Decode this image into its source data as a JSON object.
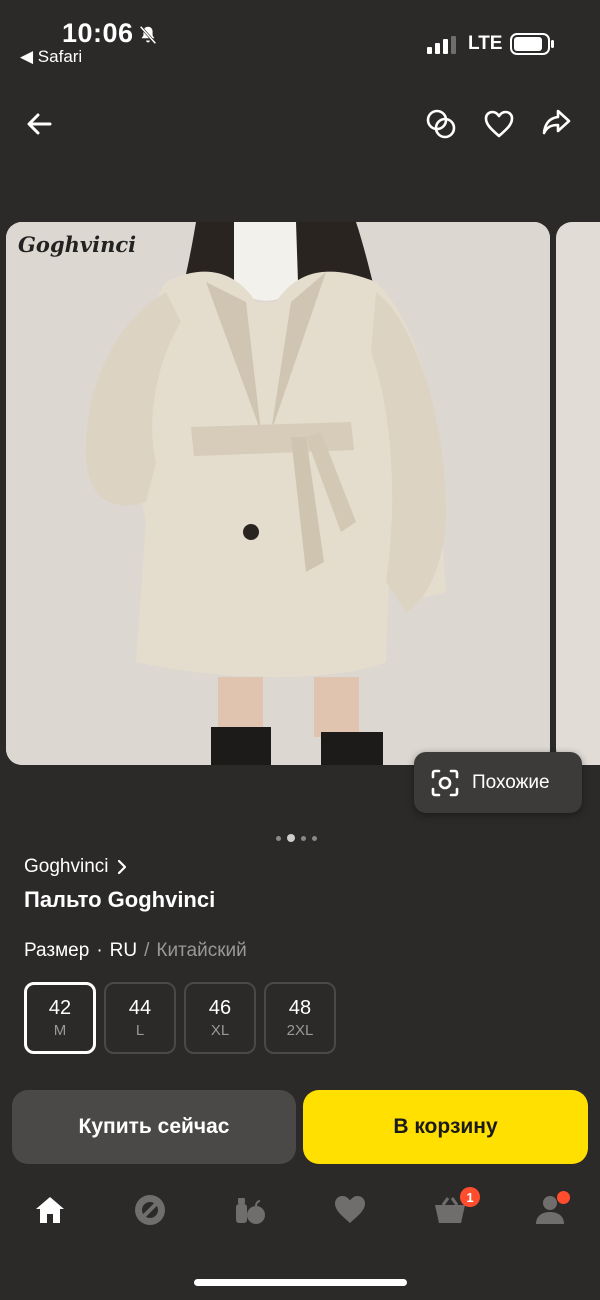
{
  "status_bar": {
    "time": "10:06",
    "back_app": "◀ Safari",
    "network": "LTE"
  },
  "toolbar": {
    "back_icon": "arrow-left-icon",
    "compare_icon": "compare-icon",
    "favorite_icon": "heart-icon",
    "share_icon": "share-icon"
  },
  "gallery": {
    "watermark": "Goghvinci",
    "similar_label": "Похожие",
    "page_count": 4,
    "current_page": 2
  },
  "product": {
    "brand": "Goghvinci",
    "title": "Пальто Goghvinci"
  },
  "size_selector": {
    "label": "Размер",
    "separator": "·",
    "system_active": "RU",
    "system_divider": "/",
    "system_alt": "Китайский",
    "options": [
      {
        "size": "42",
        "label": "M",
        "selected": true
      },
      {
        "size": "44",
        "label": "L",
        "selected": false
      },
      {
        "size": "46",
        "label": "XL",
        "selected": false
      },
      {
        "size": "48",
        "label": "2XL",
        "selected": false
      }
    ]
  },
  "actions": {
    "buy_now": "Купить сейчас",
    "add_to_cart": "В корзину"
  },
  "colors": {
    "background": "#2b2a29",
    "accent": "#ffe000",
    "badge": "#ff4d2e"
  },
  "bottom_nav": {
    "items": [
      "home-icon",
      "alice-icon",
      "grocery-icon",
      "favorites-icon",
      "cart-icon",
      "profile-icon"
    ],
    "cart_badge": "1"
  }
}
